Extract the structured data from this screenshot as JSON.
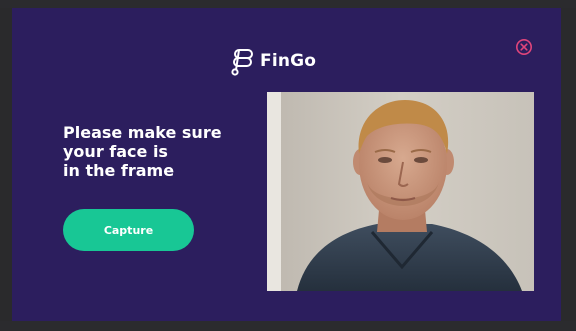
{
  "brand": {
    "name": "FinGo",
    "icon": "fingo-logo-icon"
  },
  "close": {
    "icon": "close-circle-icon",
    "color": "#e0457b"
  },
  "instruction": {
    "lines": [
      "Please make sure",
      "your face is",
      "in the frame"
    ]
  },
  "capture_button": {
    "label": "Capture",
    "color": "#18c795"
  },
  "camera": {
    "content": "live-camera-preview"
  },
  "colors": {
    "modal_background": "#2c1e5e",
    "text": "#ffffff"
  }
}
